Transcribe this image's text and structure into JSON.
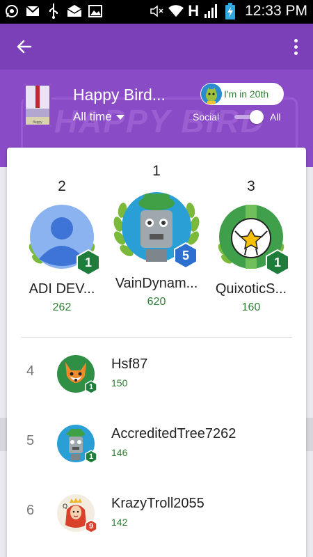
{
  "status_bar": {
    "time": "12:33 PM",
    "network": "H",
    "icons": [
      "whatsapp-icon",
      "gmail-icon",
      "usb-icon",
      "email-icon",
      "image-icon",
      "mute-icon",
      "wifi-icon",
      "signal-icon",
      "battery-charging-icon"
    ]
  },
  "app_bar": {
    "back_icon": "arrow-back-icon",
    "menu_icon": "more-vert-icon"
  },
  "header": {
    "game_title": "Happy Bird...",
    "watermark": "HAPPY BIRD",
    "time_filter": "All time",
    "player_rank_label": "I'm in 20th",
    "toggle_left_label": "Social",
    "toggle_right_label": "All",
    "toggle_on": true,
    "game_icon_caption": "flappy"
  },
  "podium": [
    {
      "rank": "2",
      "name": "ADI DEV...",
      "score": "262",
      "level": "1",
      "avatar": "default-person-avatar"
    },
    {
      "rank": "1",
      "name": "VainDynam...",
      "score": "620",
      "level": "5",
      "avatar": "robot-avatar"
    },
    {
      "rank": "3",
      "name": "QuixoticS...",
      "score": "160",
      "level": "1",
      "avatar": "soccer-ball-avatar"
    }
  ],
  "leaderboard": [
    {
      "rank": "4",
      "name": "Hsf87",
      "score": "150",
      "level": "1",
      "avatar": "fox-avatar"
    },
    {
      "rank": "5",
      "name": "AccreditedTree7262",
      "score": "146",
      "level": "1",
      "avatar": "robot-avatar"
    },
    {
      "rank": "6",
      "name": "KrazyTroll2055",
      "score": "142",
      "level": "9",
      "avatar": "queen-card-avatar"
    }
  ],
  "colors": {
    "primary_purple": "#7b3fb8",
    "header_purple": "#8a4cc6",
    "score_green": "#2e7d32",
    "level_badge_green": "#1e7d3a",
    "level_badge_blue": "#2d6fd0",
    "level_badge_red": "#d9412b"
  }
}
